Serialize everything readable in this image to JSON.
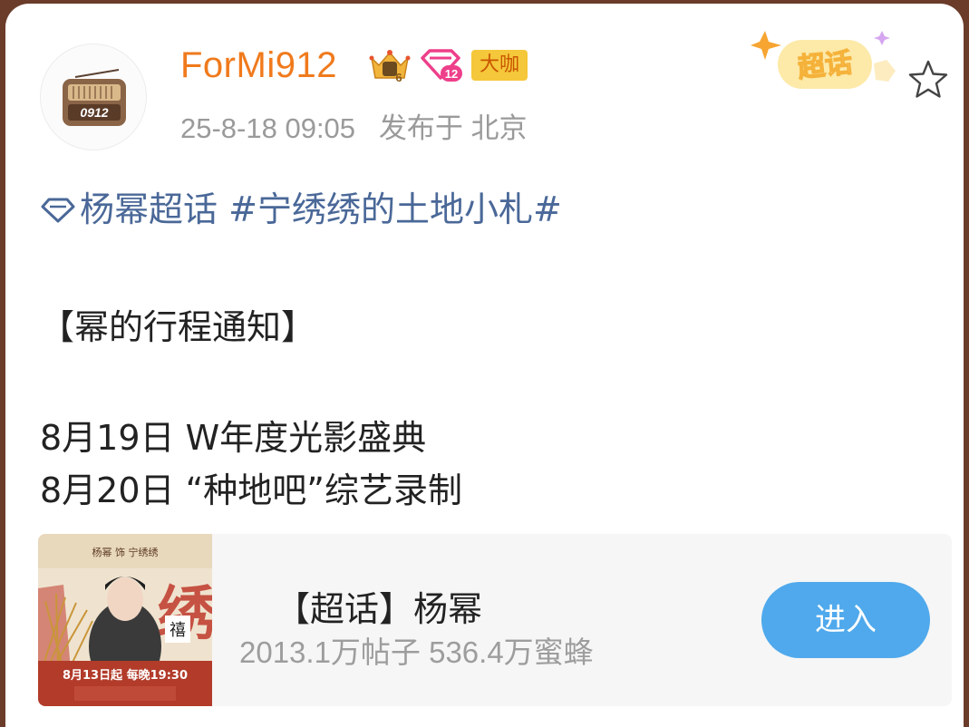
{
  "post": {
    "username": "ForMi912",
    "level_badge_text": "6",
    "super_badge_text": "12",
    "role_badge": "大咖",
    "timestamp": "25-8-18 09:05",
    "location": "发布于 北京",
    "sticker_label": "超话",
    "avatar_text": "0912",
    "avatar_icon": "radio-icon",
    "follow_icon": "star-outline-icon"
  },
  "content": {
    "topic_super": "杨幂超话",
    "topic_hashtag": "#宁绣绣的土地小札#",
    "heading": "【幂的行程通知】",
    "lines": [
      "8月19日 W年度光影盛典",
      "8月20日 “种地吧”综艺录制"
    ]
  },
  "supertopic_card": {
    "title": "【超话】杨幂",
    "stats": "2013.1万帖子 536.4万蜜蜂",
    "button_label": "进入",
    "poster": {
      "top_label": "杨幂 饰 宁绣绣",
      "big_char": "绣",
      "bottom_label": "8月13日起 每晚19:30",
      "stamp_char": "禧"
    }
  },
  "colors": {
    "username": "#f07a1c",
    "link": "#4a6898",
    "button": "#4fa9ec",
    "poster_red": "#b23b2a"
  }
}
